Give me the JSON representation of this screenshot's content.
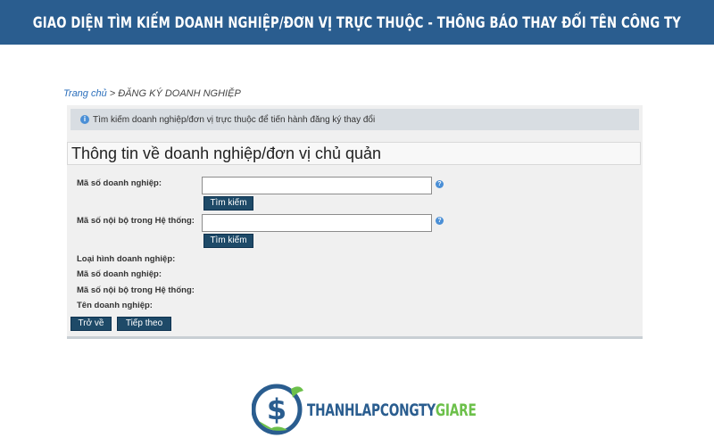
{
  "banner": {
    "title": "GIAO DIỆN TÌM KIẾM DOANH NGHIỆP/ĐƠN VỊ TRỰC THUỘC - THÔNG BÁO THAY ĐỔI TÊN CÔNG TY"
  },
  "breadcrumb": {
    "home": "Trang chủ",
    "separator": " > ",
    "current": "ĐĂNG KÝ DOANH NGHIỆP"
  },
  "info": {
    "icon": "info-icon",
    "text": "Tìm kiếm doanh nghiệp/đơn vị trực thuộc để tiến hành đăng ký thay đổi"
  },
  "section": {
    "title": "Thông tin về doanh nghiệp/đơn vị chủ quản"
  },
  "form": {
    "enterprise_code_label": "Mã số doanh nghiệp:",
    "enterprise_code_value": "",
    "internal_code_label": "Mã số nội bộ trong Hệ thống:",
    "internal_code_value": "",
    "search_label": "Tìm kiếm",
    "help_icon": "question-icon"
  },
  "results": {
    "type_label": "Loại hình doanh nghiệp:",
    "enterprise_code_label": "Mã số doanh nghiệp:",
    "internal_code_label": "Mã số nội bộ trong Hệ thống:",
    "name_label": "Tên doanh nghiệp:"
  },
  "actions": {
    "back_label": "Trở về",
    "next_label": "Tiếp theo"
  },
  "logo": {
    "text_main": "THANHLAPCONGTY",
    "text_accent": "GIARE",
    "icon": "dollar-leaf-logo"
  },
  "colors": {
    "banner": "#2a5d8f",
    "button": "#1e4a68",
    "link": "#2a6ebb",
    "logo_green": "#6cc04a"
  }
}
